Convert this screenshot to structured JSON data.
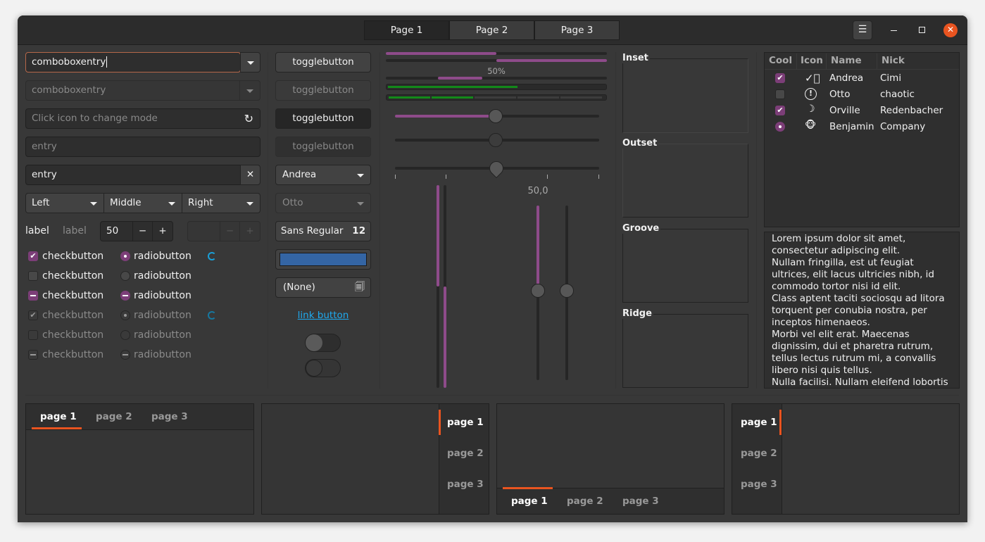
{
  "header": {
    "tabs": [
      "Page 1",
      "Page 2",
      "Page 3"
    ],
    "active_tab": 0,
    "close_color": "#e95420"
  },
  "left": {
    "combo_entry": "comboboxentry",
    "combo_entry_disabled": "comboboxentry",
    "mode_placeholder": "Click icon to change mode",
    "entry_placeholder": "entry",
    "entry_value": "entry",
    "combos": [
      "Left",
      "Middle",
      "Right"
    ],
    "label1": "label",
    "label2": "label",
    "spin_value": "50",
    "check_label": "checkbutton",
    "radio_label": "radiobutton"
  },
  "middle": {
    "toggle": "togglebutton",
    "combo1": "Andrea",
    "combo2": "Otto",
    "font_name": "Sans Regular",
    "font_size": "12",
    "color": "#3465a4",
    "file": "(None)",
    "link": "link button",
    "switch1_on": false,
    "switch2_on": false
  },
  "progress": {
    "label": "50%",
    "scale_value": "50,0",
    "values": [
      50,
      50,
      50,
      60,
      40
    ],
    "slider": 50
  },
  "frames": [
    "Inset",
    "Outset",
    "Groove",
    "Ridge"
  ],
  "tree": {
    "columns": [
      "Cool",
      "Icon",
      "Name",
      "Nick"
    ],
    "rows": [
      {
        "cool": "checked",
        "icon": "check-circle-icon",
        "name": "Andrea",
        "nick": "Cimi"
      },
      {
        "cool": "unchecked",
        "icon": "warning-icon",
        "name": "Otto",
        "nick": "chaotic"
      },
      {
        "cool": "checked",
        "icon": "moon-icon",
        "name": "Orville",
        "nick": "Redenbacher"
      },
      {
        "cool": "radio",
        "icon": "monkey-icon",
        "name": "Benjamin",
        "nick": "Company"
      }
    ]
  },
  "textview": [
    "Lorem ipsum dolor sit amet,",
    "consectetur adipiscing elit.",
    "Nullam fringilla, est ut feugiat",
    "ultrices, elit lacus ultricies nibh, id",
    "commodo tortor nisi id elit.",
    "Class aptent taciti sociosqu ad litora",
    "torquent per conubia nostra, per",
    "inceptos himenaeos.",
    "Morbi vel elit erat. Maecenas",
    "dignissim, dui et pharetra rutrum,",
    "tellus lectus rutrum mi, a convallis",
    "libero nisi quis tellus.",
    "Nulla facilisi. Nullam eleifend lobortis"
  ],
  "notebook_tabs": [
    "page 1",
    "page 2",
    "page 3"
  ],
  "accent": "#e95420",
  "purple": "#7c3e78"
}
